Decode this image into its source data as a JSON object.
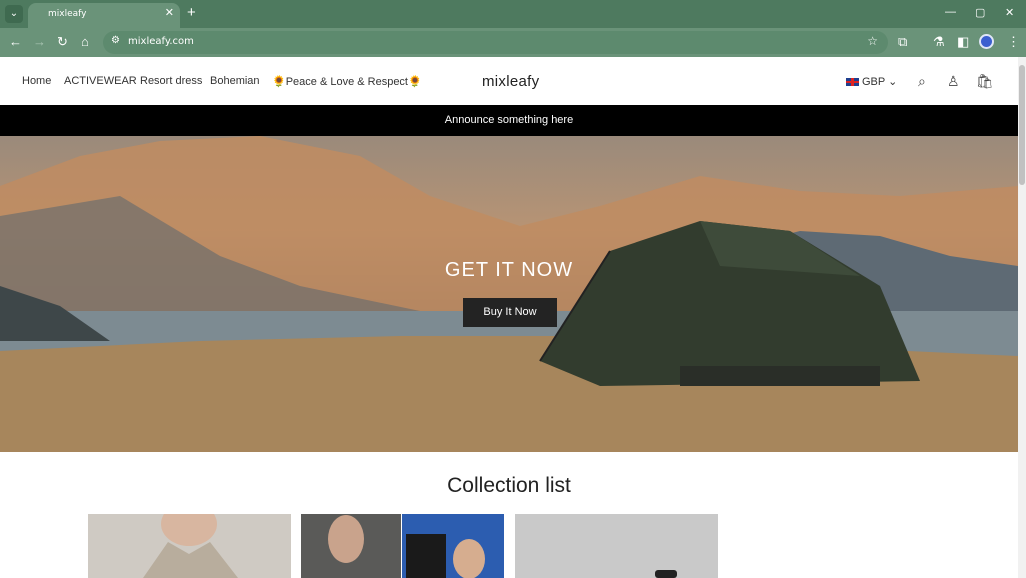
{
  "browser": {
    "tab_title": "mixleafy",
    "url": "mixleafy.com"
  },
  "header": {
    "menu": [
      {
        "label": "Home"
      },
      {
        "label": "ACTIVEWEAR"
      },
      {
        "label": "Resort dress"
      },
      {
        "label": "Bohemian"
      },
      {
        "label": "🌻Peace & Love & Respect🌻"
      }
    ],
    "logo": "mixleafy",
    "currency": "GBP"
  },
  "announcement": "Announce something here",
  "hero": {
    "title": "GET IT NOW",
    "button": "Buy It Now"
  },
  "collection": {
    "title": "Collection list"
  },
  "colors": {
    "chrome": "#4e7a5f",
    "announcement_bg": "#000000",
    "button_bg": "#232323"
  }
}
